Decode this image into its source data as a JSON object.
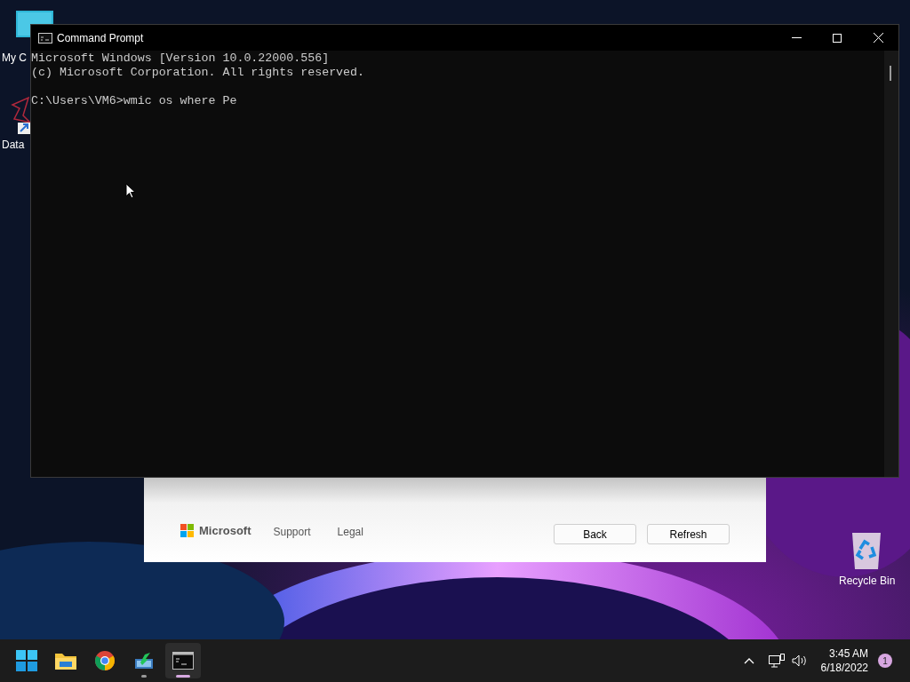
{
  "desktop_icons": [
    {
      "label": "My C",
      "kind": "monitor"
    },
    {
      "label": "Data",
      "kind": "shortcut"
    },
    {
      "label": "Recycle Bin",
      "kind": "recycle"
    }
  ],
  "background_dialog": {
    "brand": "Microsoft",
    "links": [
      "Support",
      "Legal"
    ],
    "buttons": [
      "Back",
      "Refresh"
    ]
  },
  "window": {
    "title": "Command Prompt",
    "banner": [
      "Microsoft Windows [Version 10.0.22000.556]",
      "(c) Microsoft Corporation. All rights reserved."
    ],
    "prompt": "C:\\Users\\VM6>wmic os where Pe"
  },
  "taskbar": {
    "apps": [
      {
        "kind": "start",
        "selected": false,
        "running": false
      },
      {
        "kind": "folder",
        "selected": false,
        "running": false
      },
      {
        "kind": "browser",
        "selected": false,
        "running": false
      },
      {
        "kind": "installer",
        "selected": false,
        "running": true
      },
      {
        "kind": "terminal",
        "selected": true,
        "running": true
      }
    ],
    "tray": {
      "time": "3:45 AM",
      "date": "6/18/2022",
      "notifications": "1"
    }
  }
}
